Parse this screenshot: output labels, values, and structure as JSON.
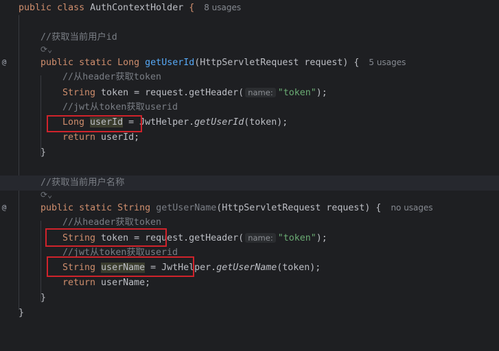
{
  "class_decl": {
    "kw1": "public",
    "kw2": "class",
    "name": "AuthContextHolder",
    "brace": "{",
    "usages": "8 usages"
  },
  "method1": {
    "doc": "//获取当前用户id",
    "kw1": "public",
    "kw2": "static",
    "ret": "Long",
    "name": "getUserId",
    "params": "(HttpServletRequest request)",
    "brace": "{",
    "usages": "5 usages",
    "c1": "//从header获取token",
    "l1_type": "String",
    "l1_mid": " token = request.getHeader(",
    "l1_hint": "name:",
    "l1_str": "\"token\"",
    "l1_end": ");",
    "c2": "//jwt从token获取userid",
    "l2_type": "Long",
    "l2_var": "userId",
    "l2_mid": " = JwtHelper.",
    "l2_fn": "getUserId",
    "l2_end": "(token);",
    "ret_kw": "return",
    "ret_rest": " userId;",
    "close": "}"
  },
  "method2": {
    "doc": "//获取当前用户名称",
    "kw1": "public",
    "kw2": "static",
    "ret": "String",
    "name": "getUserName",
    "params": "(HttpServletRequest request)",
    "brace": "{",
    "usages": "no usages",
    "c1": "//从header获取token",
    "l1_type": "String",
    "l1_mid": " token = request.getHeader(",
    "l1_hint": "name:",
    "l1_str": "\"token\"",
    "l1_end": ");",
    "c2": "//jwt从token获取userid",
    "l2_type": "String",
    "l2_var": "userName",
    "l2_mid": " = JwtHelper.",
    "l2_fn": "getUserName",
    "l2_end": "(token);",
    "ret_kw": "return",
    "ret_rest": " userName;",
    "close": "}"
  },
  "class_close": "}",
  "gutter_icon": "@",
  "fold_glyph": "⟳⌄",
  "colors": {
    "background": "#1e1f22",
    "keyword": "#cf8e6d",
    "method": "#56a8f5",
    "string": "#6aab73",
    "comment": "#7a7e85",
    "annotation_box": "#d0232b"
  }
}
